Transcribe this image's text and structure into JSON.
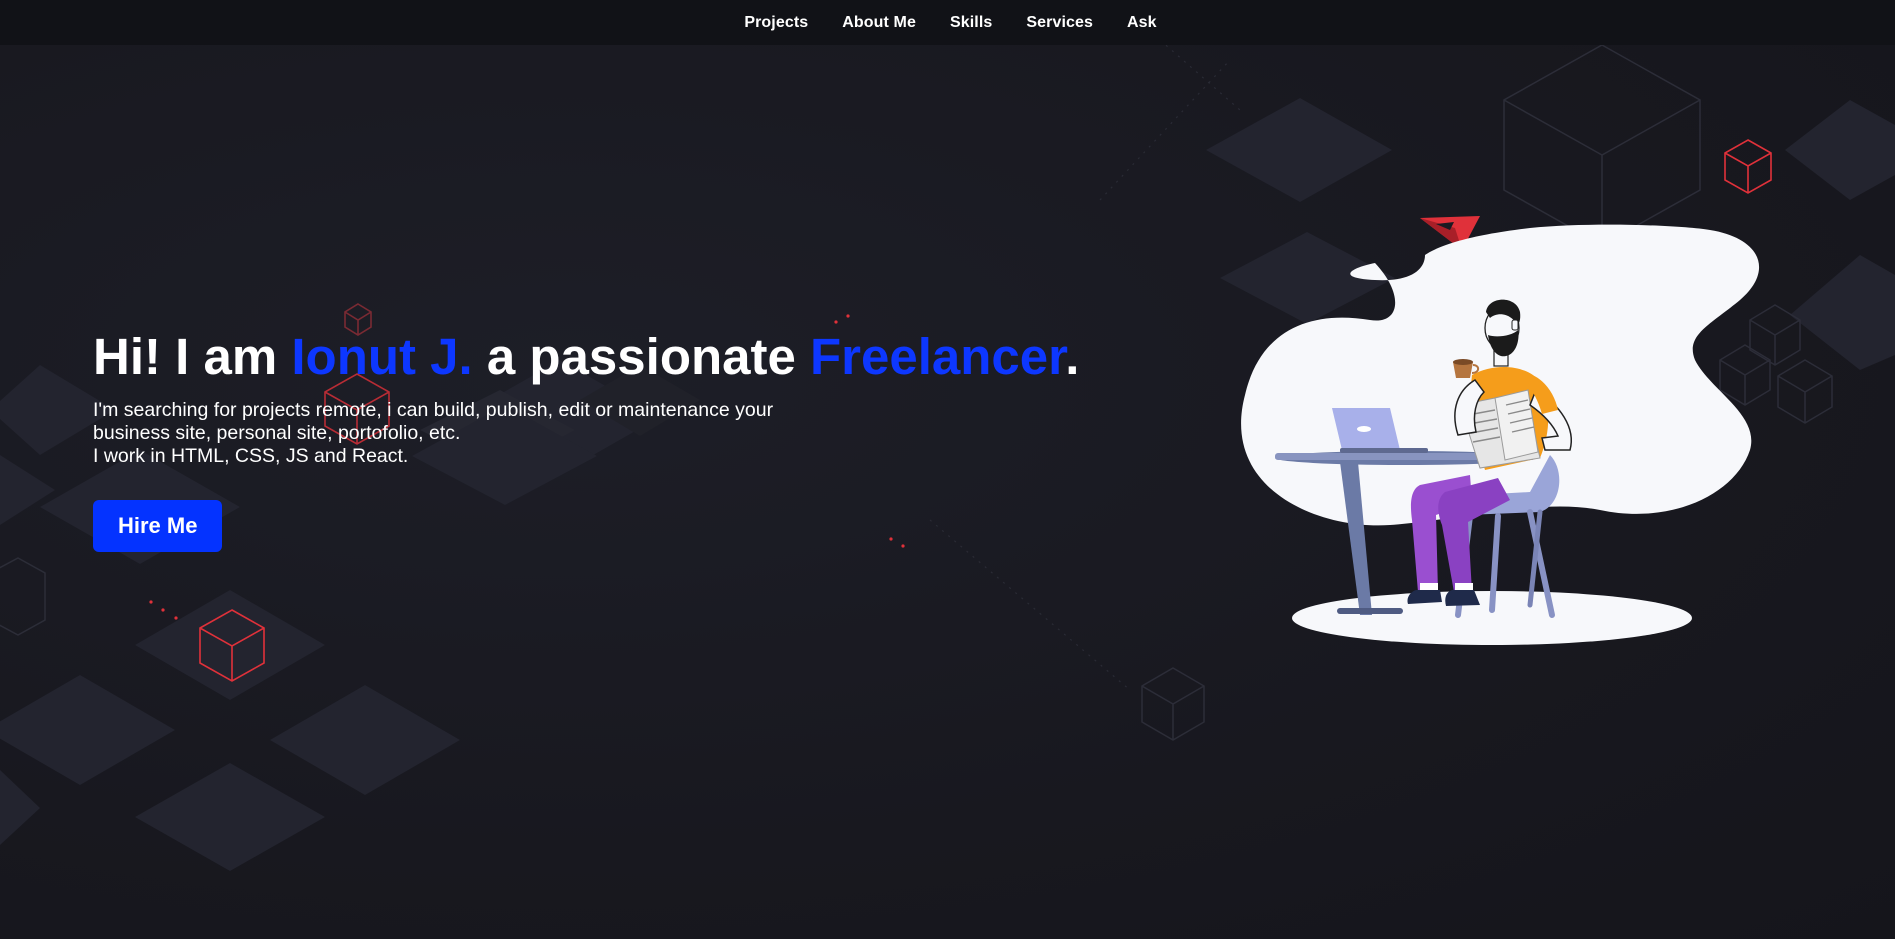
{
  "nav": {
    "items": [
      "Projects",
      "About Me",
      "Skills",
      "Services",
      "Ask"
    ]
  },
  "hero": {
    "title_prefix": "Hi! I am ",
    "name": "Ionut J.",
    "title_middle": " a passionate ",
    "role": "Freelancer",
    "title_suffix": ".",
    "description_line1": "I'm searching for projects remote, i can build, publish, edit or maintenance your business site, personal site, portofolio, etc.",
    "description_line2": "I work in HTML, CSS, JS and React.",
    "button_label": "Hire Me"
  },
  "colors": {
    "accent": "#0d37ff",
    "button": "#0433ff",
    "background": "#1a1a22",
    "navbar": "#111217",
    "cube_red": "#e0313a",
    "tile": "#23242f"
  },
  "icons": {
    "illustration": "freelancer-reading-at-cafe-table",
    "paper_plane": "paper-plane-icon"
  }
}
